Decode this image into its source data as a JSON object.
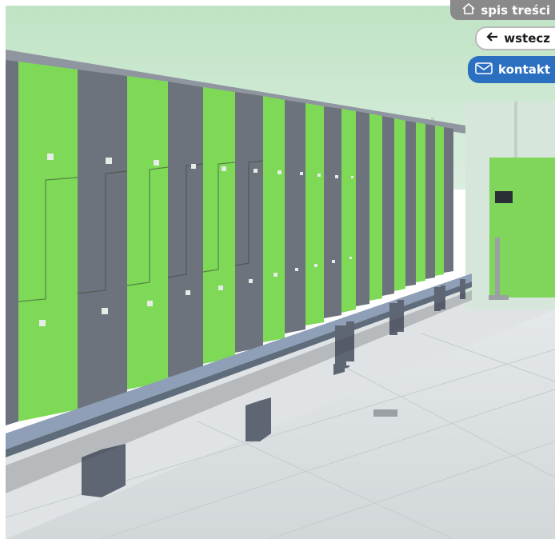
{
  "nav": {
    "toc_label": "spis treści",
    "back_label": "wstecz",
    "contact_label": "kontakt"
  },
  "icons": {
    "toc": "house-icon",
    "back": "arrow-left-icon",
    "contact": "envelope-icon"
  },
  "colors": {
    "toc_bg": "#8a8a8a",
    "contact_bg": "#2a6fc0",
    "locker_green": "#7ed957",
    "locker_grey": "#6d737c"
  }
}
